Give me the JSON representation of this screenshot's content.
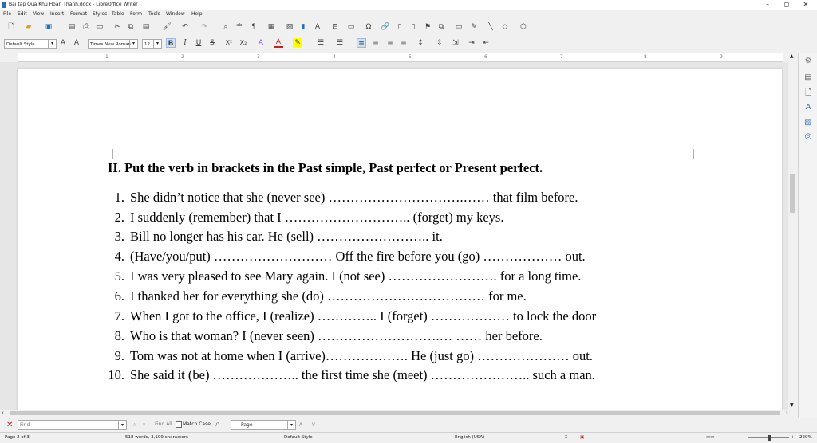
{
  "window": {
    "title": "Bai tap Qua Khu Hoan Thanh.docx - LibreOffice Writer",
    "minimize": "–",
    "maximize": "◻",
    "close": "✕"
  },
  "menu": [
    "File",
    "Edit",
    "View",
    "Insert",
    "Format",
    "Styles",
    "Table",
    "Form",
    "Tools",
    "Window",
    "Help"
  ],
  "formatting": {
    "paragraph_style": "Default Style",
    "font_name": "Times New Roman",
    "font_size": "12"
  },
  "ruler_numbers": [
    "1",
    "2",
    "3",
    "4",
    "5",
    "6",
    "7",
    "8",
    "9"
  ],
  "document": {
    "heading": "II. Put the verb in brackets in the Past simple, Past perfect or Present perfect.",
    "exercises": [
      {
        "num": "1.",
        "text": "She didn’t notice that she (never see) ………………………….…… that film before."
      },
      {
        "num": "2.",
        "text": "I suddenly (remember) that I ……………………….. (forget) my keys."
      },
      {
        "num": "3.",
        "text": "Bill no longer has his car. He (sell) …………………….. it."
      },
      {
        "num": "4.",
        "text": "(Have/you/put) ……………………… Off the fire before you (go) ……………… out."
      },
      {
        "num": "5.",
        "text": "I was very pleased to see Mary again. I (not see) ……………………. for a long time."
      },
      {
        "num": "6.",
        "text": "I thanked her for everything she (do) ……………………………… for me."
      },
      {
        "num": "7.",
        "text": "When I got to the office, I (realize) ………….. I (forget) ……………… to lock the door"
      },
      {
        "num": "8.",
        "text": "Who is that woman? I (never seen) ……………………….… …… her before."
      },
      {
        "num": "9.",
        "text": "Tom was not at home when I (arrive)………………. He (just go) ………………… out."
      },
      {
        "num": "10.",
        "text": "She said it (be) ……………….. the first time she (meet) ………………….. such a man."
      }
    ]
  },
  "findbar": {
    "placeholder": "Find",
    "find_all": "Find All",
    "match_case": "Match Case",
    "search_scope": "Page"
  },
  "status": {
    "page": "Page 2 of 3",
    "words": "518 words, 3,109 characters",
    "style": "Default Style",
    "language": "English (USA)",
    "zoom": "220%"
  },
  "colors": {
    "accent": "#2a6fb5",
    "font_color": "#c9211e",
    "highlight": "#ffff00"
  }
}
